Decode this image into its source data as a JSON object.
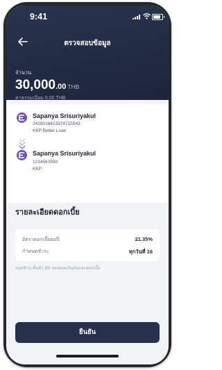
{
  "status": {
    "time": "9:41"
  },
  "header": {
    "title": "ตรวจสอบข้อมูล"
  },
  "amount": {
    "label": "จำนวน",
    "whole": "30,000",
    "decimals": ".00",
    "currency": "THB",
    "fee": "ค่าธรรมเนียม 0.00 THB"
  },
  "from": {
    "name": "Sapanya Srisuriyakul",
    "account": "2428016423374715543",
    "bank": "KKP Better Loan"
  },
  "to": {
    "name": "Sapanya Srisuriyakul",
    "account": "1234567890",
    "bank": "KKP"
  },
  "details": {
    "title": "รายละเอียดดอกเบี้ย",
    "rows": [
      {
        "label": "อัตราดอกเบี้ยต่อปี",
        "value": "21.35%"
      },
      {
        "label": "กำหนดชำระ",
        "value": "ทุกวันที่ 16"
      }
    ],
    "note": "ยอดชำระขั้นต่ำ 3% ของยอดเงินต้นและดอกเบี้ย"
  },
  "confirm_label": "ยืนยัน",
  "colors": {
    "header": "#26314b",
    "bank_icon": "#7053b6",
    "page_bg": "#f2f3f6"
  },
  "icons": {
    "back": "arrow-left-icon",
    "bank": "kkp-bank-icon",
    "flow": "chevron-down-icon"
  }
}
